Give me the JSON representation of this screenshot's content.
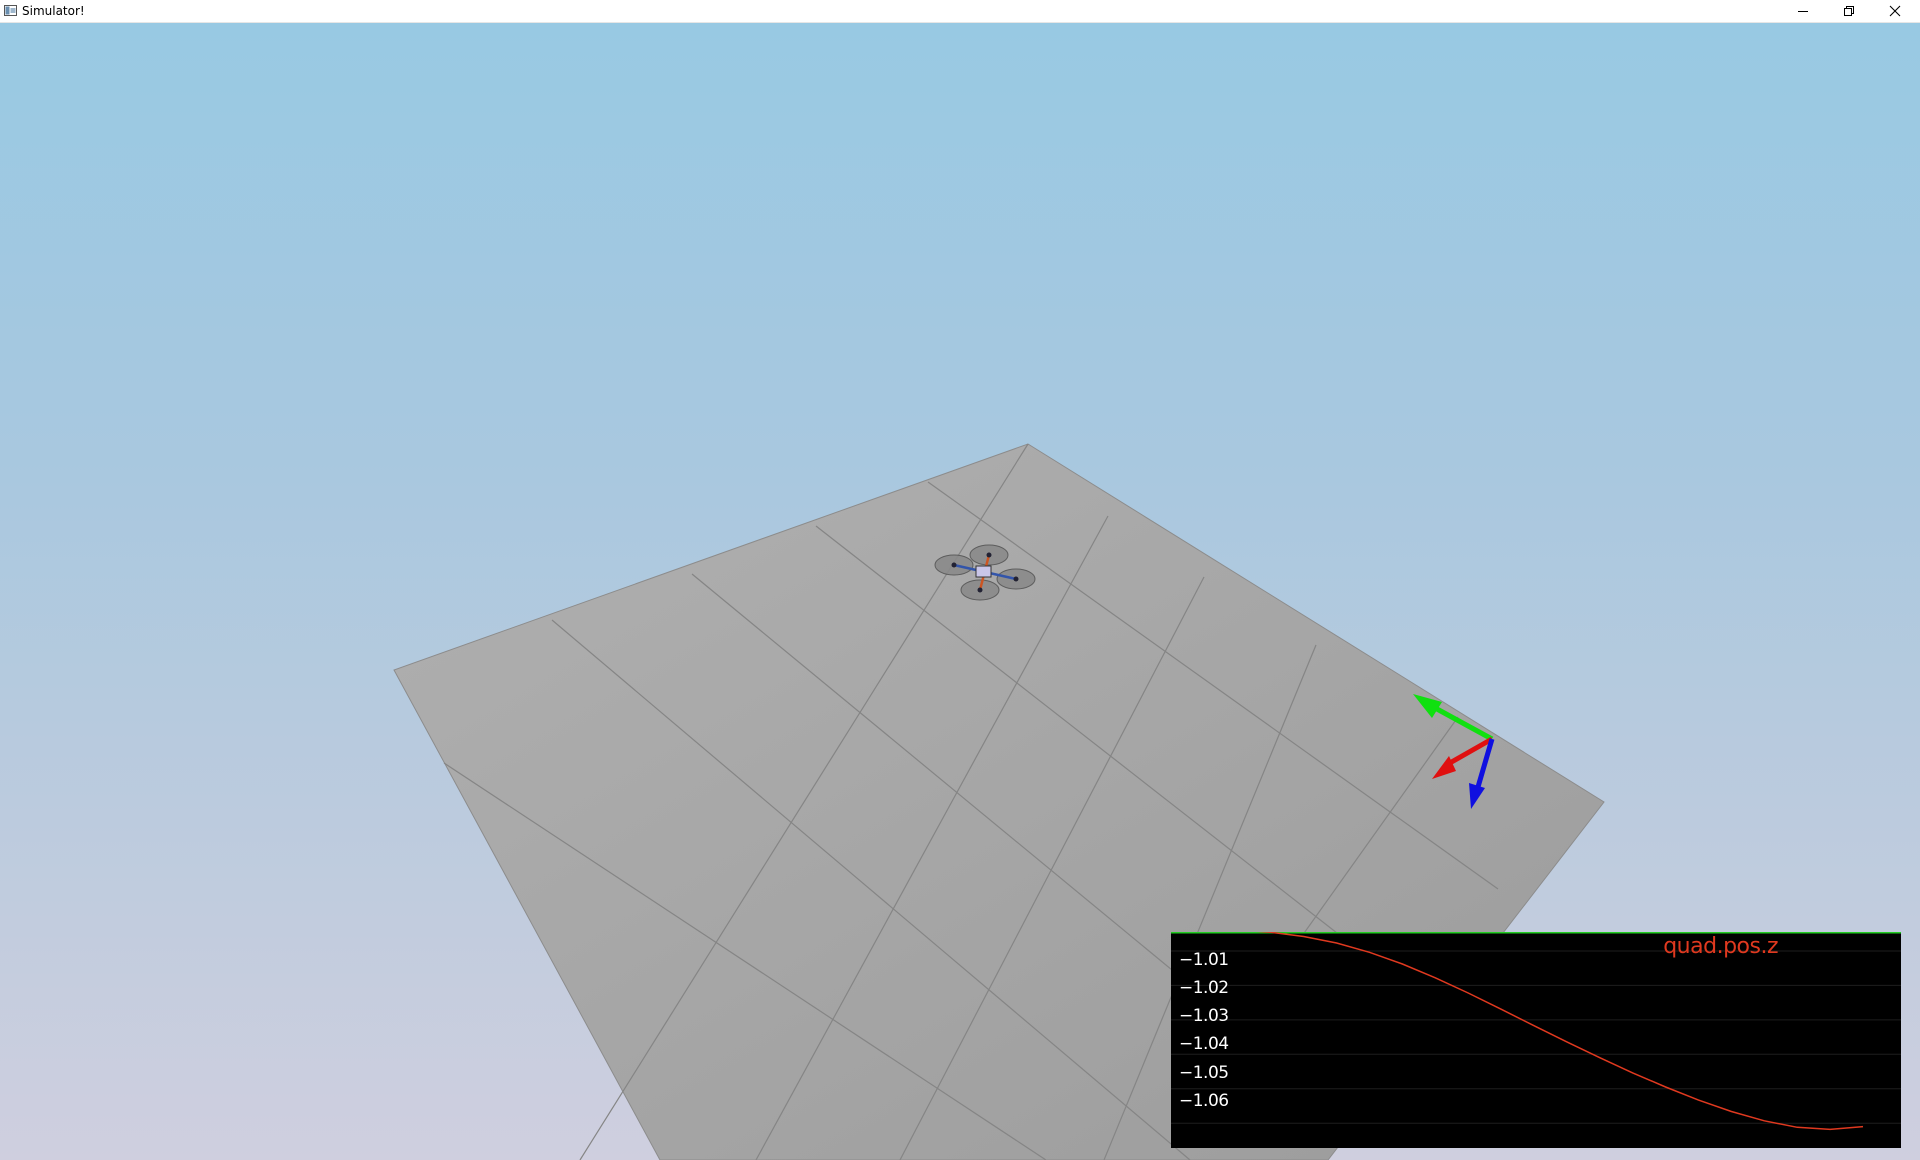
{
  "window": {
    "title": "Simulator!",
    "icons": {
      "app": "app-window-icon",
      "minimize": "minimize-icon",
      "restore": "restore-icon",
      "close": "close-icon"
    }
  },
  "scene": {
    "ground_color": "#a8a8a8",
    "grid_line_color": "#858585",
    "axes_colors": {
      "x": "#e01010",
      "y": "#10e010",
      "z": "#1010e0"
    }
  },
  "plot": {
    "title": "quad.pos.z",
    "background": "#000000",
    "line_color": "#e0391f",
    "top_line_color": "#22cc22",
    "chart_data": {
      "type": "line",
      "title": "quad.pos.z",
      "y_ticks": [
        "−1.01",
        "−1.02",
        "−1.03",
        "−1.04",
        "−1.05",
        "−1.06"
      ],
      "y_tick_values": [
        -1.01,
        -1.02,
        -1.03,
        -1.04,
        -1.05,
        -1.06
      ],
      "ylim": [
        -1.0672,
        -1.0045
      ],
      "series": [
        {
          "x": [
            0.0,
            0.05,
            0.1,
            0.15,
            0.2,
            0.25,
            0.3,
            0.35,
            0.4,
            0.45,
            0.5,
            0.55,
            0.6,
            0.65,
            0.7,
            0.75,
            0.8,
            0.85,
            0.9,
            0.95,
            1.0
          ],
          "values": [
            -1.0036,
            -1.0039,
            -1.0046,
            -1.0058,
            -1.0077,
            -1.0104,
            -1.0138,
            -1.0178,
            -1.0222,
            -1.0269,
            -1.0317,
            -1.0364,
            -1.041,
            -1.0454,
            -1.0495,
            -1.0533,
            -1.0566,
            -1.0593,
            -1.0612,
            -1.0618,
            -1.061
          ]
        }
      ],
      "grid": true
    }
  }
}
